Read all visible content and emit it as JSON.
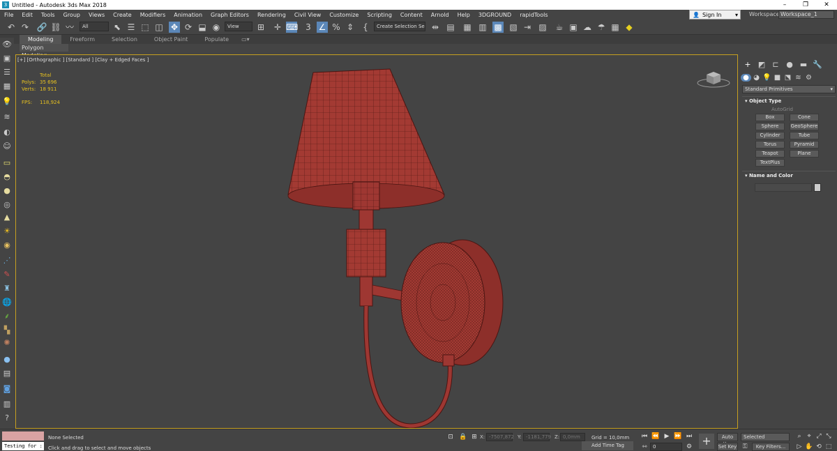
{
  "window": {
    "title": "Untitled - Autodesk 3ds Max 2018",
    "minimize": "–",
    "maximize": "❐",
    "close": "✕"
  },
  "menu": [
    "File",
    "Edit",
    "Tools",
    "Group",
    "Views",
    "Create",
    "Modifiers",
    "Animation",
    "Graph Editors",
    "Rendering",
    "Civil View",
    "Customize",
    "Scripting",
    "Content",
    "Arnold",
    "Help",
    "3DGROUND",
    "rapidTools"
  ],
  "account": {
    "sign_in": "Sign In",
    "workspaces_label": "Workspaces:",
    "workspace": "Workspace_1"
  },
  "toolbar": {
    "filter": "All",
    "view": "View",
    "selection_set": "Create Selection Se"
  },
  "ribbon": {
    "tabs": [
      "Modeling",
      "Freeform",
      "Selection",
      "Object Paint",
      "Populate"
    ],
    "active": "Modeling",
    "sub": "Polygon Modeling"
  },
  "viewport": {
    "label": "[+] [Orthographic ] [Standard ] [Clay + Edged Faces ]",
    "stats": {
      "total_label": "Total",
      "polys_label": "Polys:",
      "polys": "35 696",
      "verts_label": "Verts:",
      "verts": "18 911",
      "fps_label": "FPS:",
      "fps": "118,924"
    }
  },
  "command_panel": {
    "category": "Standard Primitives",
    "object_type_title": "Object Type",
    "autogrid": "AutoGrid",
    "primitives": [
      "Box",
      "Cone",
      "Sphere",
      "GeoSphere",
      "Cylinder",
      "Tube",
      "Torus",
      "Pyramid",
      "Teapot",
      "Plane",
      "TextPlus"
    ],
    "name_color_title": "Name and Color"
  },
  "status": {
    "testing": "Testing for :",
    "selected": "None Selected",
    "prompt": "Click and drag to select and move objects",
    "x_label": "X:",
    "x_value": "-7507,872",
    "y_label": "Y:",
    "y_value": "-1181,779",
    "z_label": "Z:",
    "z_value": "0,0mm",
    "grid": "Grid = 10,0mm",
    "add_time_tag": "Add Time Tag",
    "frame": "0",
    "auto_key": "Auto Key",
    "set_key": "Set Key",
    "key_mode": "Selected",
    "key_filters": "Key Filters..."
  },
  "colors": {
    "accent": "#5b87b8",
    "viewport_border": "#c7a020",
    "mesh": "#a33a33",
    "wire": "#4a1512"
  }
}
